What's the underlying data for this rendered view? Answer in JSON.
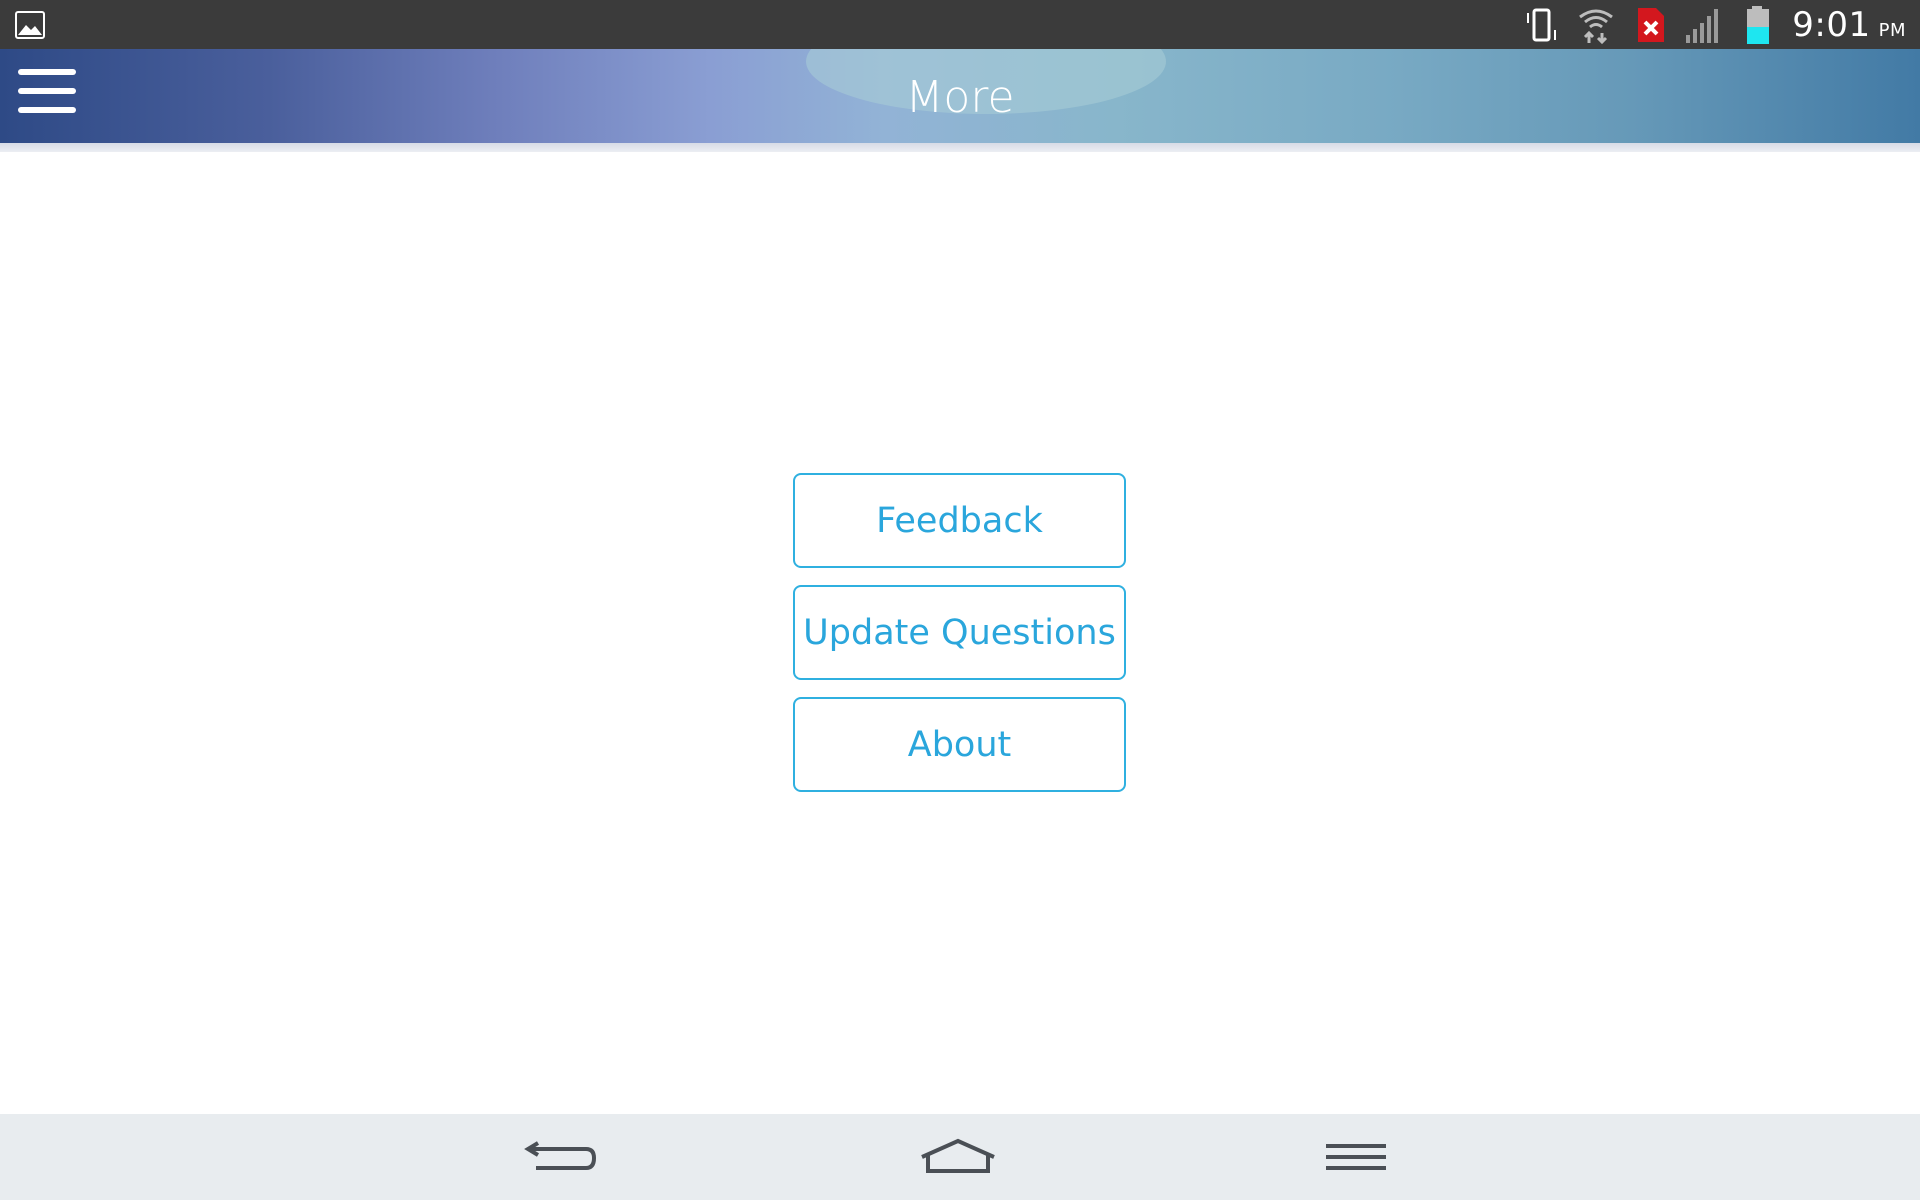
{
  "status_bar": {
    "icons": [
      "gallery-icon",
      "vibrate-icon",
      "wifi-icon",
      "sim-error-icon",
      "signal-icon",
      "battery-icon"
    ],
    "time": "9:01",
    "ampm": "PM",
    "battery_color": "#1ee6f0",
    "error_color": "#d3171e"
  },
  "header": {
    "menu_icon": "hamburger-menu-icon",
    "title": "More"
  },
  "main": {
    "buttons": [
      {
        "label": "Feedback"
      },
      {
        "label": "Update Questions"
      },
      {
        "label": "About"
      }
    ],
    "accent_color": "#2aa6dc"
  },
  "nav_bar": {
    "icons": [
      "back-icon",
      "home-icon",
      "menu-icon"
    ]
  }
}
